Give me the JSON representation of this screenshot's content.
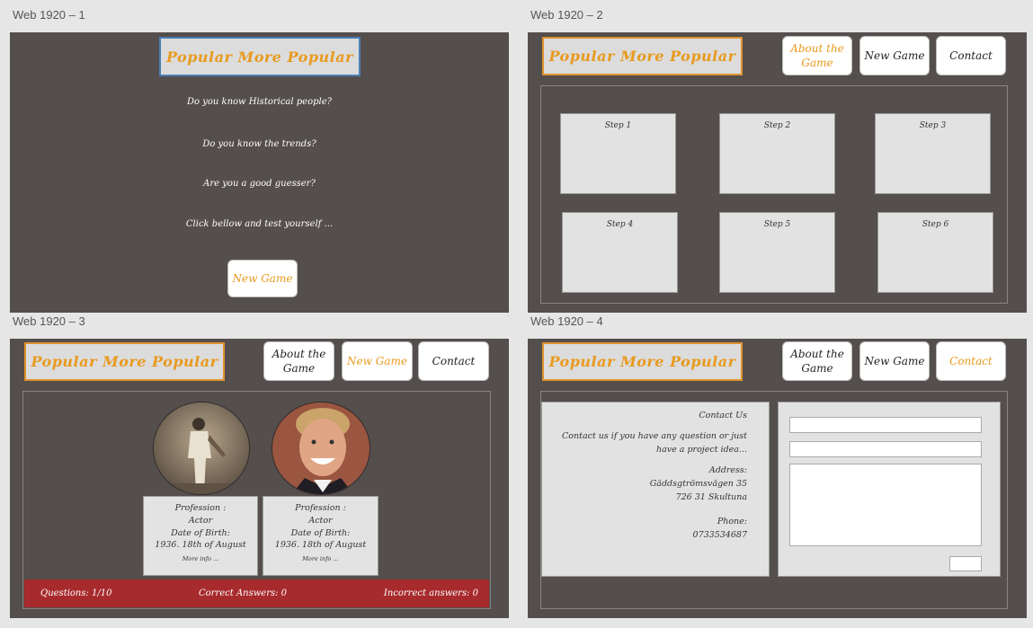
{
  "artboards": [
    {
      "label": "Web 1920 – 1"
    },
    {
      "label": "Web 1920 – 2"
    },
    {
      "label": "Web 1920 – 3"
    },
    {
      "label": "Web 1920 – 4"
    }
  ],
  "logo_text": "Popular More Popular",
  "nav": {
    "about": "About the Game",
    "new_game": "New Game",
    "contact": "Contact"
  },
  "home": {
    "lines": [
      "Do you know Historical people?",
      "Do you know the trends?",
      "Are you a good guesser?",
      "Click bellow and test yourself ..."
    ],
    "button": "New Game"
  },
  "steps": [
    "Step 1",
    "Step 2",
    "Step 3",
    "Step 4",
    "Step 5",
    "Step 6"
  ],
  "game": {
    "cards": [
      {
        "profession_label": "Profession :",
        "profession": "Actor",
        "dob_label": "Date of Birth:",
        "dob": "1936. 18th of August",
        "more": "More info ..."
      },
      {
        "profession_label": "Profession :",
        "profession": "Actor",
        "dob_label": "Date of Birth:",
        "dob": "1936. 18th of August",
        "more": "More info ..."
      }
    ],
    "status": {
      "questions": "Questions: 1/10",
      "correct": "Correct Answers: 0",
      "incorrect": "Incorrect answers: 0"
    }
  },
  "contact": {
    "title": "Contact Us",
    "intro_1": "Contact us if you have any question or just",
    "intro_2": "have a project idea...",
    "address_label": "Address:",
    "street": "Gäddsgtrömsvägen 35",
    "city": "726 31 Skultuna",
    "phone_label": "Phone:",
    "phone": "0733534687"
  },
  "colors": {
    "accent": "#e89a1e",
    "board": "#544e4d",
    "status_bar": "#a72a2d"
  }
}
